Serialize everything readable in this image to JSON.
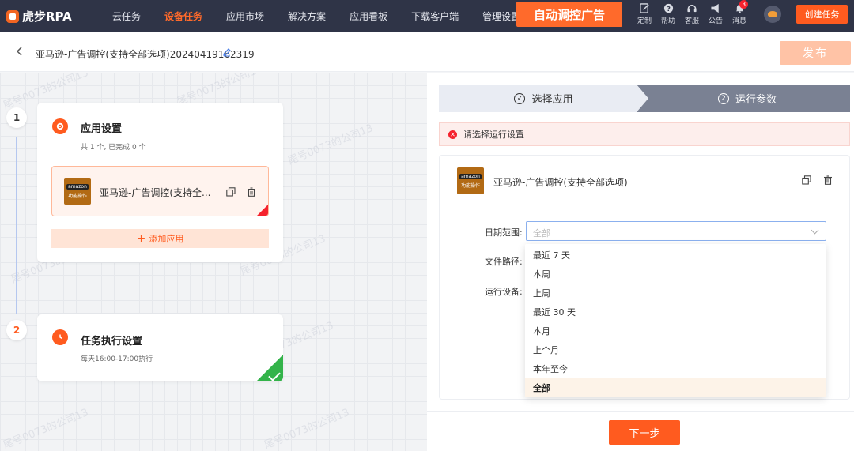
{
  "topnav": {
    "logo": "虎步RPA",
    "items": [
      "云任务",
      "设备任务",
      "应用市场",
      "解决方案",
      "应用看板",
      "下载客户端",
      "管理设置"
    ],
    "active_index": 1,
    "promo": "自动调控广告",
    "utils": [
      {
        "label": "定制",
        "icon": "edit-icon"
      },
      {
        "label": "帮助",
        "icon": "help-icon"
      },
      {
        "label": "客服",
        "icon": "headset-icon"
      },
      {
        "label": "公告",
        "icon": "megaphone-icon"
      },
      {
        "label": "消息",
        "icon": "bell-icon",
        "badge": "3"
      }
    ],
    "create_button": "创建任务"
  },
  "titlebar": {
    "title": "亚马逊-广告调控(支持全部选项)20240419162319",
    "publish": "发布"
  },
  "canvas": {
    "step1": {
      "num": "1",
      "title": "应用设置",
      "sub": "共 1 个, 已完成 0 个",
      "app_name": "亚马逊-广告调控(支持全...",
      "thumb_brand": "amazon",
      "thumb_caption": "功能操作",
      "add_label": "添加应用"
    },
    "step2": {
      "num": "2",
      "title": "任务执行设置",
      "sub": "每天16:00-17:00执行"
    },
    "watermark": "尾号0073的公司13"
  },
  "panel": {
    "steps": [
      {
        "num": "✓",
        "label": "选择应用"
      },
      {
        "num": "2",
        "label": "运行参数"
      }
    ],
    "alert": "请选择运行设置",
    "app_name": "亚马逊-广告调控(支持全部选项)",
    "thumb_brand": "amazon",
    "thumb_caption": "功能操作",
    "fields": {
      "date_label": "日期范围:",
      "date_placeholder": "全部",
      "path_label": "文件路径:",
      "device_label": "运行设备:"
    },
    "options": [
      "最近 7 天",
      "本周",
      "上周",
      "最近 30 天",
      "本月",
      "上个月",
      "本年至今",
      "全部"
    ],
    "selected_option": 7,
    "next": "下一步"
  },
  "colors": {
    "nav_bg": "#2f3447",
    "accent": "#ff5b1f",
    "success": "#33b34a",
    "error": "#f5222d"
  }
}
